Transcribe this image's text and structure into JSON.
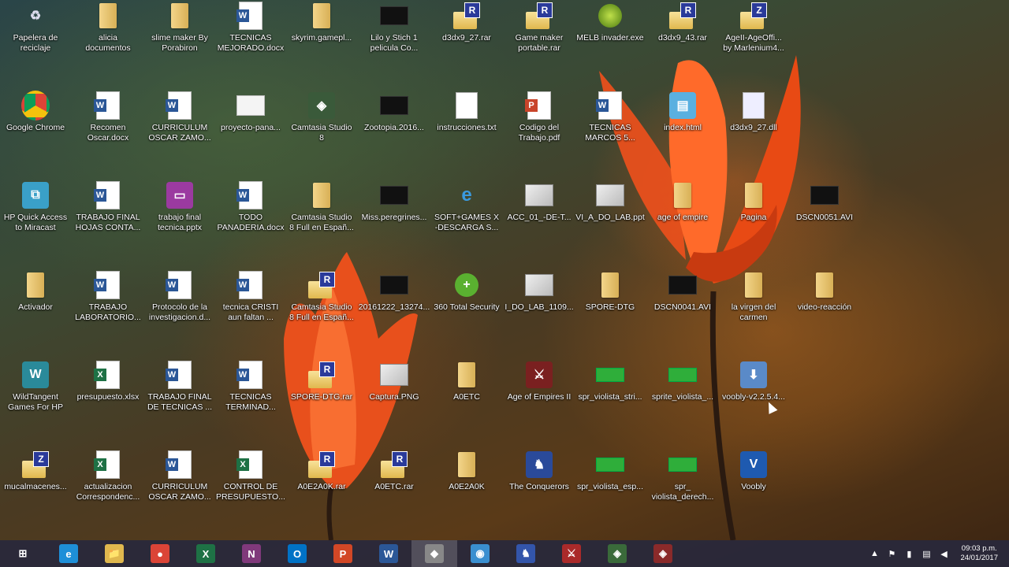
{
  "desktop": {
    "icons": [
      {
        "label": "Papelera de\nreciclaje",
        "icon": "recycle-bin-icon"
      },
      {
        "label": "alicia\ndocumentos",
        "icon": "folder-icon"
      },
      {
        "label": "slime maker By\nPorabiron",
        "icon": "folder-icon"
      },
      {
        "label": "TECNICAS\nMEJORADO.docx",
        "icon": "word-doc-icon"
      },
      {
        "label": "skyrim.gamepl...",
        "icon": "folder-icon"
      },
      {
        "label": "Lilo y Stich 1\npelicula Co...",
        "icon": "video-icon"
      },
      {
        "label": "d3dx9_27.rar",
        "icon": "rar-icon"
      },
      {
        "label": "Game maker\nportable.rar",
        "icon": "rar-icon"
      },
      {
        "label": "MELB invader.exe",
        "icon": "exe-icon"
      },
      {
        "label": "d3dx9_43.rar",
        "icon": "rar-icon"
      },
      {
        "label": "AgeII-AgeOffi...\nby Marlenium4...",
        "icon": "zip-icon"
      },
      {
        "label": "Google Chrome",
        "icon": "chrome-icon"
      },
      {
        "label": "Recomen\nOscar.docx",
        "icon": "word-doc-icon"
      },
      {
        "label": "CURRICULUM\nOSCAR ZAMO...",
        "icon": "word-doc-icon"
      },
      {
        "label": "proyecto-pana...",
        "icon": "file-icon"
      },
      {
        "label": "Camtasia Studio\n8",
        "icon": "camtasia-icon"
      },
      {
        "label": "Zootopia.2016...",
        "icon": "video-icon"
      },
      {
        "label": "instrucciones.txt",
        "icon": "text-file-icon"
      },
      {
        "label": "Codigo del\nTrabajo.pdf",
        "icon": "pdf-icon"
      },
      {
        "label": "TECNICAS\nMARCOS 5...",
        "icon": "word-doc-icon"
      },
      {
        "label": "index.html",
        "icon": "html-icon"
      },
      {
        "label": "d3dx9_27.dll",
        "icon": "dll-icon"
      },
      {
        "label": "HP Quick Access\nto Miracast",
        "icon": "hp-miracast-icon"
      },
      {
        "label": "TRABAJO FINAL\nHOJAS CONTA...",
        "icon": "word-doc-icon"
      },
      {
        "label": "trabajo final\ntecnica.pptx",
        "icon": "pptx-icon"
      },
      {
        "label": "TODO\nPANADERIA.docx",
        "icon": "word-doc-icon"
      },
      {
        "label": "Camtasia Studio\n8 Full en Españ...",
        "icon": "folder-icon"
      },
      {
        "label": "Miss.peregrines...",
        "icon": "video-icon"
      },
      {
        "label": "SOFT+GAMES X\n-DESCARGA S...",
        "icon": "ie-shortcut-icon"
      },
      {
        "label": "ACC_01_-DE-T...",
        "icon": "image-icon"
      },
      {
        "label": "VI_A_DO_LAB.ppt",
        "icon": "image-icon"
      },
      {
        "label": "age of empire",
        "icon": "folder-icon"
      },
      {
        "label": "Pagina",
        "icon": "folder-icon"
      },
      {
        "label": "DSCN0051.AVI",
        "icon": "video-icon"
      },
      {
        "label": "Activador",
        "icon": "folder-icon"
      },
      {
        "label": "TRABAJO\nLABORATORIO...",
        "icon": "word-doc-icon"
      },
      {
        "label": "Protocolo de la\ninvestigacion.d...",
        "icon": "word-doc-icon"
      },
      {
        "label": "tecnica CRISTI\naun faltan ...",
        "icon": "word-doc-icon"
      },
      {
        "label": "Camtasia Studio\n8 Full en Españ...",
        "icon": "rar-icon"
      },
      {
        "label": "20161222_13274...",
        "icon": "video-icon"
      },
      {
        "label": "360 Total Security",
        "icon": "security-icon"
      },
      {
        "label": "I_DO_LAB_1109...",
        "icon": "image-icon"
      },
      {
        "label": "SPORE-DTG",
        "icon": "folder-icon"
      },
      {
        "label": "DSCN0041.AVI",
        "icon": "video-icon"
      },
      {
        "label": "la virgen del\ncarmen",
        "icon": "folder-icon"
      },
      {
        "label": "video-reacción",
        "icon": "folder-icon"
      },
      {
        "label": "WildTangent\nGames For HP",
        "icon": "wildtangent-icon"
      },
      {
        "label": "presupuesto.xlsx",
        "icon": "excel-doc-icon"
      },
      {
        "label": "TRABAJO FINAL\nDE TECNICAS ...",
        "icon": "word-doc-icon"
      },
      {
        "label": "TECNICAS\nTERMINAD...",
        "icon": "word-doc-icon"
      },
      {
        "label": "SPORE-DTG.rar",
        "icon": "rar-icon"
      },
      {
        "label": "Captura.PNG",
        "icon": "image-icon"
      },
      {
        "label": "A0ETC",
        "icon": "folder-icon"
      },
      {
        "label": "Age of Empires II",
        "icon": "aoe-icon"
      },
      {
        "label": "spr_violista_stri...",
        "icon": "sprite-icon"
      },
      {
        "label": "sprite_violista_...",
        "icon": "sprite-icon"
      },
      {
        "label": "voobly-v2.2.5.4...",
        "icon": "installer-icon"
      },
      {
        "label": "mucalmacenes...",
        "icon": "zip-icon"
      },
      {
        "label": "actualizacion\nCorrespondenc...",
        "icon": "excel-doc-icon"
      },
      {
        "label": "CURRICULUM\nOSCAR ZAMO...",
        "icon": "word-doc-icon"
      },
      {
        "label": "CONTROL DE\nPRESUPUESTO...",
        "icon": "excel-doc-icon"
      },
      {
        "label": "A0E2A0K.rar",
        "icon": "rar-icon"
      },
      {
        "label": "A0ETC.rar",
        "icon": "rar-icon"
      },
      {
        "label": "A0E2A0K",
        "icon": "folder-icon"
      },
      {
        "label": "The Conquerors",
        "icon": "conquerors-icon"
      },
      {
        "label": "spr_violista_esp...",
        "icon": "sprite-icon"
      },
      {
        "label": "spr_\nviolista_derech...",
        "icon": "sprite-icon"
      },
      {
        "label": "Voobly",
        "icon": "voobly-icon"
      }
    ]
  },
  "taskbar": {
    "items": [
      {
        "name": "start-button",
        "icon": "windows-logo-icon",
        "label": "⊞",
        "color": "#ffffff"
      },
      {
        "name": "taskbar-ie",
        "icon": "internet-explorer-icon",
        "label": "e",
        "color": "#1e8fd8"
      },
      {
        "name": "taskbar-file-explorer",
        "icon": "file-explorer-icon",
        "label": "📁",
        "color": "#e0b84e"
      },
      {
        "name": "taskbar-chrome",
        "icon": "chrome-icon",
        "label": "●",
        "color": "#db4437"
      },
      {
        "name": "taskbar-excel",
        "icon": "excel-icon",
        "label": "X",
        "color": "#1e7145"
      },
      {
        "name": "taskbar-onenote",
        "icon": "onenote-icon",
        "label": "N",
        "color": "#80397b"
      },
      {
        "name": "taskbar-outlook",
        "icon": "outlook-icon",
        "label": "O",
        "color": "#0072c6"
      },
      {
        "name": "taskbar-powerpoint",
        "icon": "powerpoint-icon",
        "label": "P",
        "color": "#d24726"
      },
      {
        "name": "taskbar-word",
        "icon": "word-icon",
        "label": "W",
        "color": "#2b5797"
      },
      {
        "name": "taskbar-app-1",
        "icon": "program-icon",
        "label": "◆",
        "color": "#888888"
      },
      {
        "name": "taskbar-app-2",
        "icon": "globe-icon",
        "label": "◉",
        "color": "#3a8fd0"
      },
      {
        "name": "taskbar-app-3",
        "icon": "conquerors-icon",
        "label": "♞",
        "color": "#3355aa"
      },
      {
        "name": "taskbar-app-4",
        "icon": "aoe-icon",
        "label": "⚔",
        "color": "#aa2a2a"
      },
      {
        "name": "taskbar-app-5",
        "icon": "camtasia-icon",
        "label": "◈",
        "color": "#3a6a3a"
      },
      {
        "name": "taskbar-app-6",
        "icon": "camtasia-recorder-icon",
        "label": "◈",
        "color": "#8a2a2a"
      }
    ],
    "active_index": 9,
    "tray": {
      "icons": [
        "chevron-up-icon",
        "flag-icon",
        "battery-icon",
        "network-icon",
        "volume-icon"
      ],
      "time": "09:03 p.m.",
      "date": "24/01/2017"
    }
  }
}
